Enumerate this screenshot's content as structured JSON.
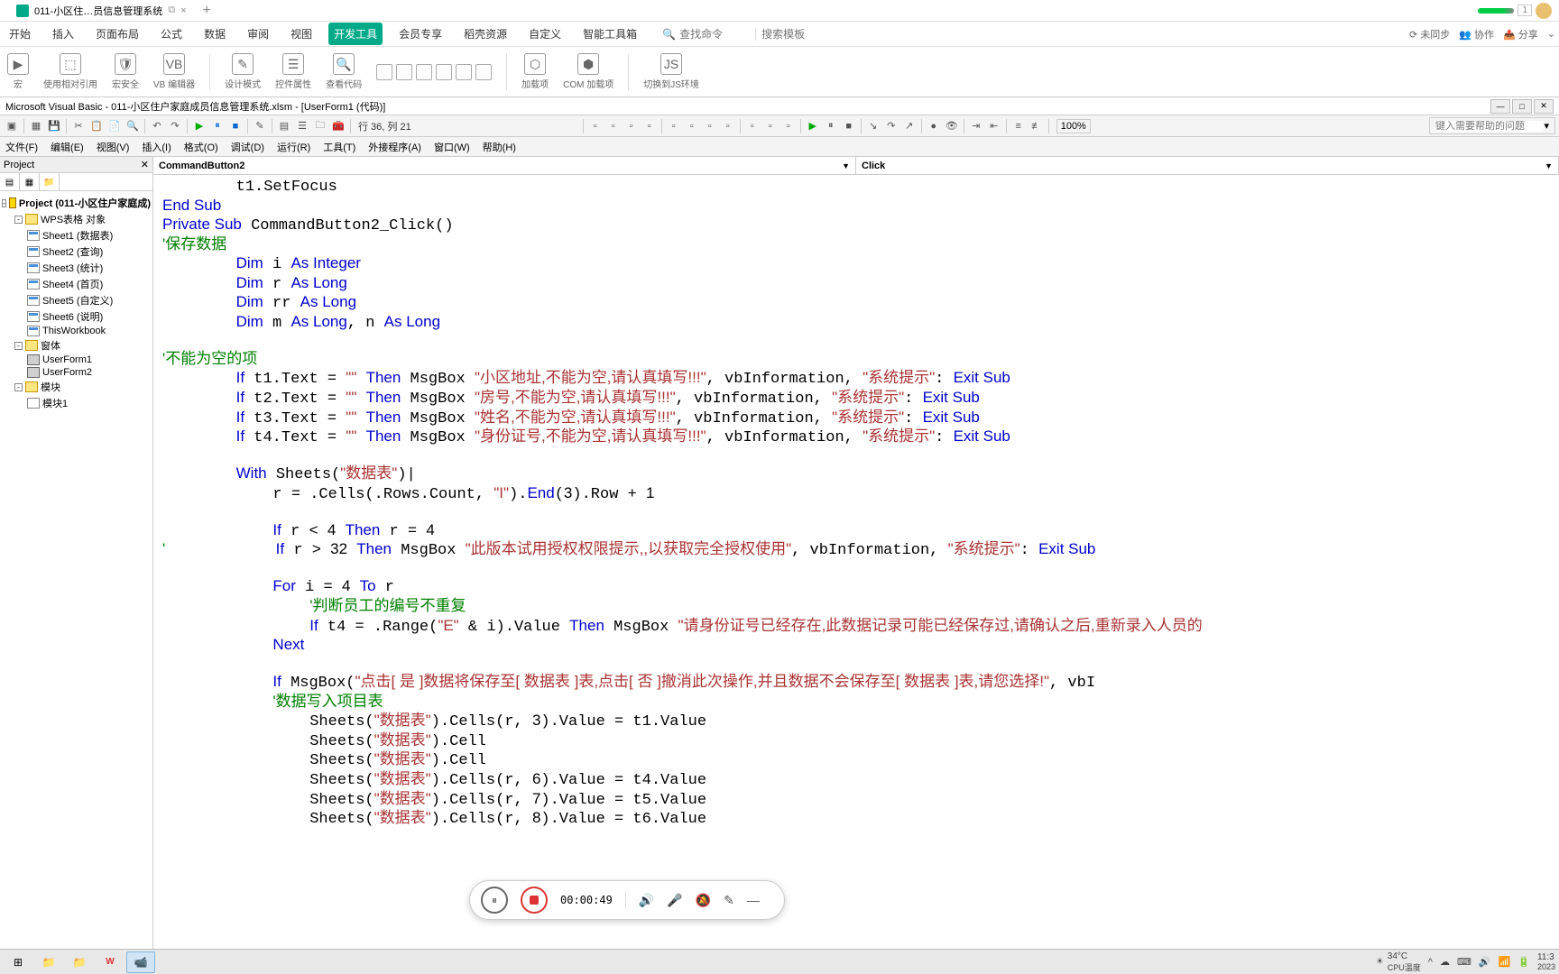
{
  "titlebar": {
    "tab_title": "011-小区住…员信息管理系统",
    "doc_badge": "1"
  },
  "ribbon": {
    "tabs": [
      "开始",
      "插入",
      "页面布局",
      "公式",
      "数据",
      "审阅",
      "视图",
      "开发工具",
      "会员专享",
      "稻壳资源",
      "自定义",
      "智能工具箱"
    ],
    "active_index": 7,
    "search_placeholder": "查找命令",
    "template_placeholder": "搜索模板",
    "right": [
      "未同步",
      "协作",
      "分享"
    ],
    "groups": [
      "宏",
      "使用相对引用",
      "宏安全",
      "VB 编辑器",
      "设计模式",
      "控件属性",
      "查看代码",
      "加载项",
      "COM 加载项",
      "切换到JS环境"
    ]
  },
  "vbe": {
    "title": "Microsoft Visual Basic - 011-小区住户家庭成员信息管理系统.xlsm - [UserForm1 (代码)]",
    "position": "行 36, 列 21",
    "zoom": "100%",
    "search_placeholder": "键入需要帮助的问题",
    "menus": [
      "文件(F)",
      "编辑(E)",
      "视图(V)",
      "插入(I)",
      "格式(O)",
      "调试(D)",
      "运行(R)",
      "工具(T)",
      "外接程序(A)",
      "窗口(W)",
      "帮助(H)"
    ]
  },
  "project": {
    "title": "Project",
    "root": "Project (011-小区住户家庭成)",
    "folders": {
      "objects": "WPS表格 对象",
      "forms": "窗体",
      "modules": "模块"
    },
    "sheets": [
      "Sheet1 (数据表)",
      "Sheet2 (查询)",
      "Sheet3 (统计)",
      "Sheet4 (首页)",
      "Sheet5 (自定义)",
      "Sheet6 (说明)",
      "ThisWorkbook"
    ],
    "forms_items": [
      "UserForm1",
      "UserForm2"
    ],
    "modules_items": [
      "模块1"
    ]
  },
  "code_dd": {
    "left": "CommandButton2",
    "right": "Click"
  },
  "recorder": {
    "time": "00:00:49"
  },
  "taskbar": {
    "weather_temp": "34°C",
    "weather_label": "CPU温度",
    "time": "11:3",
    "date": "2023"
  }
}
